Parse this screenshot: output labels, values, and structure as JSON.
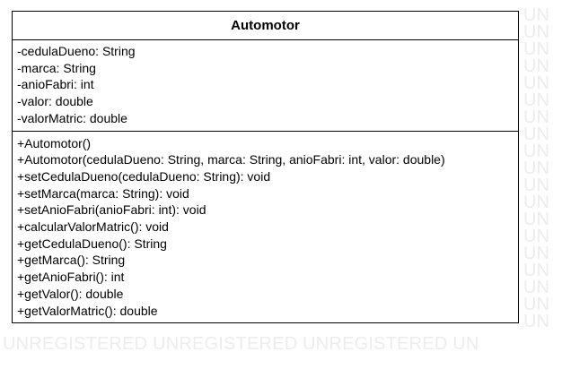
{
  "watermark": {
    "text": "UNREGISTERED",
    "right_fragment": "UN"
  },
  "class": {
    "name": "Automotor",
    "attributes": [
      "-cedulaDueno: String",
      "-marca: String",
      "-anioFabri: int",
      "-valor: double",
      "-valorMatric: double"
    ],
    "operations": [
      "+Automotor()",
      "+Automotor(cedulaDueno: String, marca: String, anioFabri: int, valor: double)",
      "+setCedulaDueno(cedulaDueno: String): void",
      "+setMarca(marca: String): void",
      "+setAnioFabri(anioFabri: int): void",
      "+calcularValorMatric(): void",
      "+getCedulaDueno(): String",
      "+getMarca(): String",
      "+getAnioFabri(): int",
      "+getValor(): double",
      "+getValorMatric(): double"
    ]
  }
}
